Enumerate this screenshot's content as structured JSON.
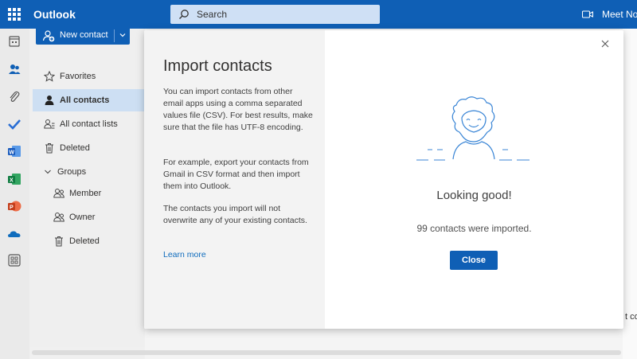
{
  "topbar": {
    "app_title": "Outlook",
    "search_placeholder": "Search",
    "meet_label": "Meet Now"
  },
  "toolbar": {
    "new_contact_label": "New contact"
  },
  "nav": {
    "favorites": "Favorites",
    "all_contacts": "All contacts",
    "all_contact_lists": "All contact lists",
    "deleted": "Deleted",
    "groups": "Groups",
    "member": "Member",
    "owner": "Owner",
    "groups_deleted": "Deleted"
  },
  "modal": {
    "title": "Import contacts",
    "para1": "You can import contacts from other email apps using a comma separated values file (CSV). For best results, make sure that the file has UTF-8 encoding.",
    "para2": "For example, export your contacts from Gmail in CSV format and then import them into Outlook.",
    "para3": "The contacts you import will not overwrite any of your existing contacts.",
    "learn_more": "Learn more",
    "result_title": "Looking good!",
    "result_text": "99 contacts were imported.",
    "close_label": "Close"
  },
  "background": {
    "cut_text": "t co"
  },
  "colors": {
    "brand": "#0f5fb5",
    "active_nav": "#cddff3",
    "link": "#0f6cbd"
  }
}
